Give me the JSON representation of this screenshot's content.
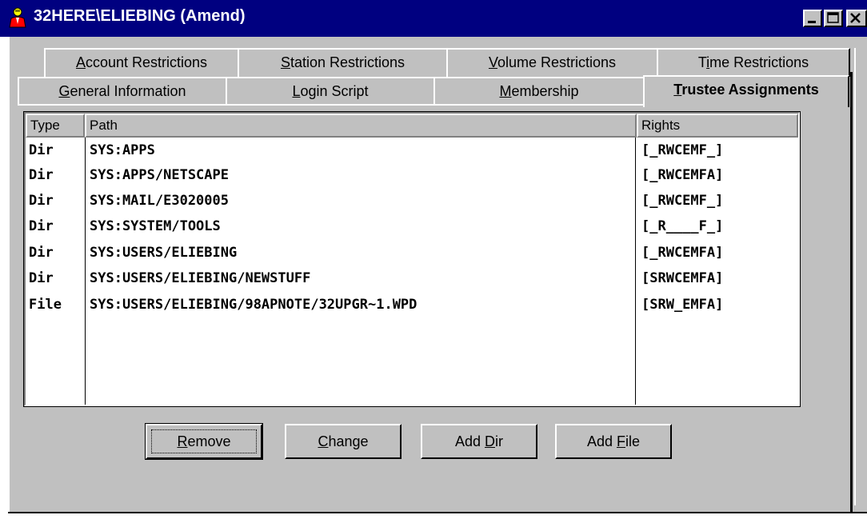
{
  "window": {
    "title": "32HERE\\ELIEBING (Amend)",
    "title_bar_color": "#000080",
    "face_color": "#c0c0c0"
  },
  "icons": {
    "app": "user-person-icon",
    "minimize": "minimize-icon",
    "maximize": "maximize-icon",
    "close": "close-icon"
  },
  "tabs_row1": [
    {
      "pre": "",
      "key": "A",
      "post": "ccount Restrictions"
    },
    {
      "pre": "",
      "key": "S",
      "post": "tation Restrictions"
    },
    {
      "pre": "",
      "key": "V",
      "post": "olume Restrictions"
    },
    {
      "pre": "T",
      "key": "i",
      "post": "me Restrictions"
    }
  ],
  "tabs_row2": [
    {
      "pre": "",
      "key": "G",
      "post": "eneral Information"
    },
    {
      "pre": "",
      "key": "L",
      "post": "ogin Script"
    },
    {
      "pre": "",
      "key": "M",
      "post": "embership"
    },
    {
      "pre": "",
      "key": "T",
      "post": "rustee Assignments"
    }
  ],
  "active_tab": "Trustee Assignments",
  "table": {
    "headers": {
      "type": "Type",
      "path": "Path",
      "rights": "Rights"
    },
    "rows": [
      {
        "type": "Dir",
        "path": "SYS:APPS",
        "rights": "[_RWCEMF_]"
      },
      {
        "type": "Dir",
        "path": "SYS:APPS/NETSCAPE",
        "rights": "[_RWCEMFA]"
      },
      {
        "type": "Dir",
        "path": "SYS:MAIL/E3020005",
        "rights": "[_RWCEMF_]"
      },
      {
        "type": "Dir",
        "path": "SYS:SYSTEM/TOOLS",
        "rights": "[_R____F_]"
      },
      {
        "type": "Dir",
        "path": "SYS:USERS/ELIEBING",
        "rights": "[_RWCEMFA]"
      },
      {
        "type": "Dir",
        "path": "SYS:USERS/ELIEBING/NEWSTUFF",
        "rights": "[SRWCEMFA]"
      },
      {
        "type": "File",
        "path": "SYS:USERS/ELIEBING/98APNOTE/32UPGR~1.WPD",
        "rights": "[SRW_EMFA]"
      }
    ]
  },
  "buttons": {
    "remove": {
      "pre": "",
      "key": "R",
      "post": "emove"
    },
    "change": {
      "pre": "",
      "key": "C",
      "post": "hange"
    },
    "add_dir": {
      "pre": "Add ",
      "key": "D",
      "post": "ir"
    },
    "add_file": {
      "pre": "Add ",
      "key": "F",
      "post": "ile"
    }
  }
}
